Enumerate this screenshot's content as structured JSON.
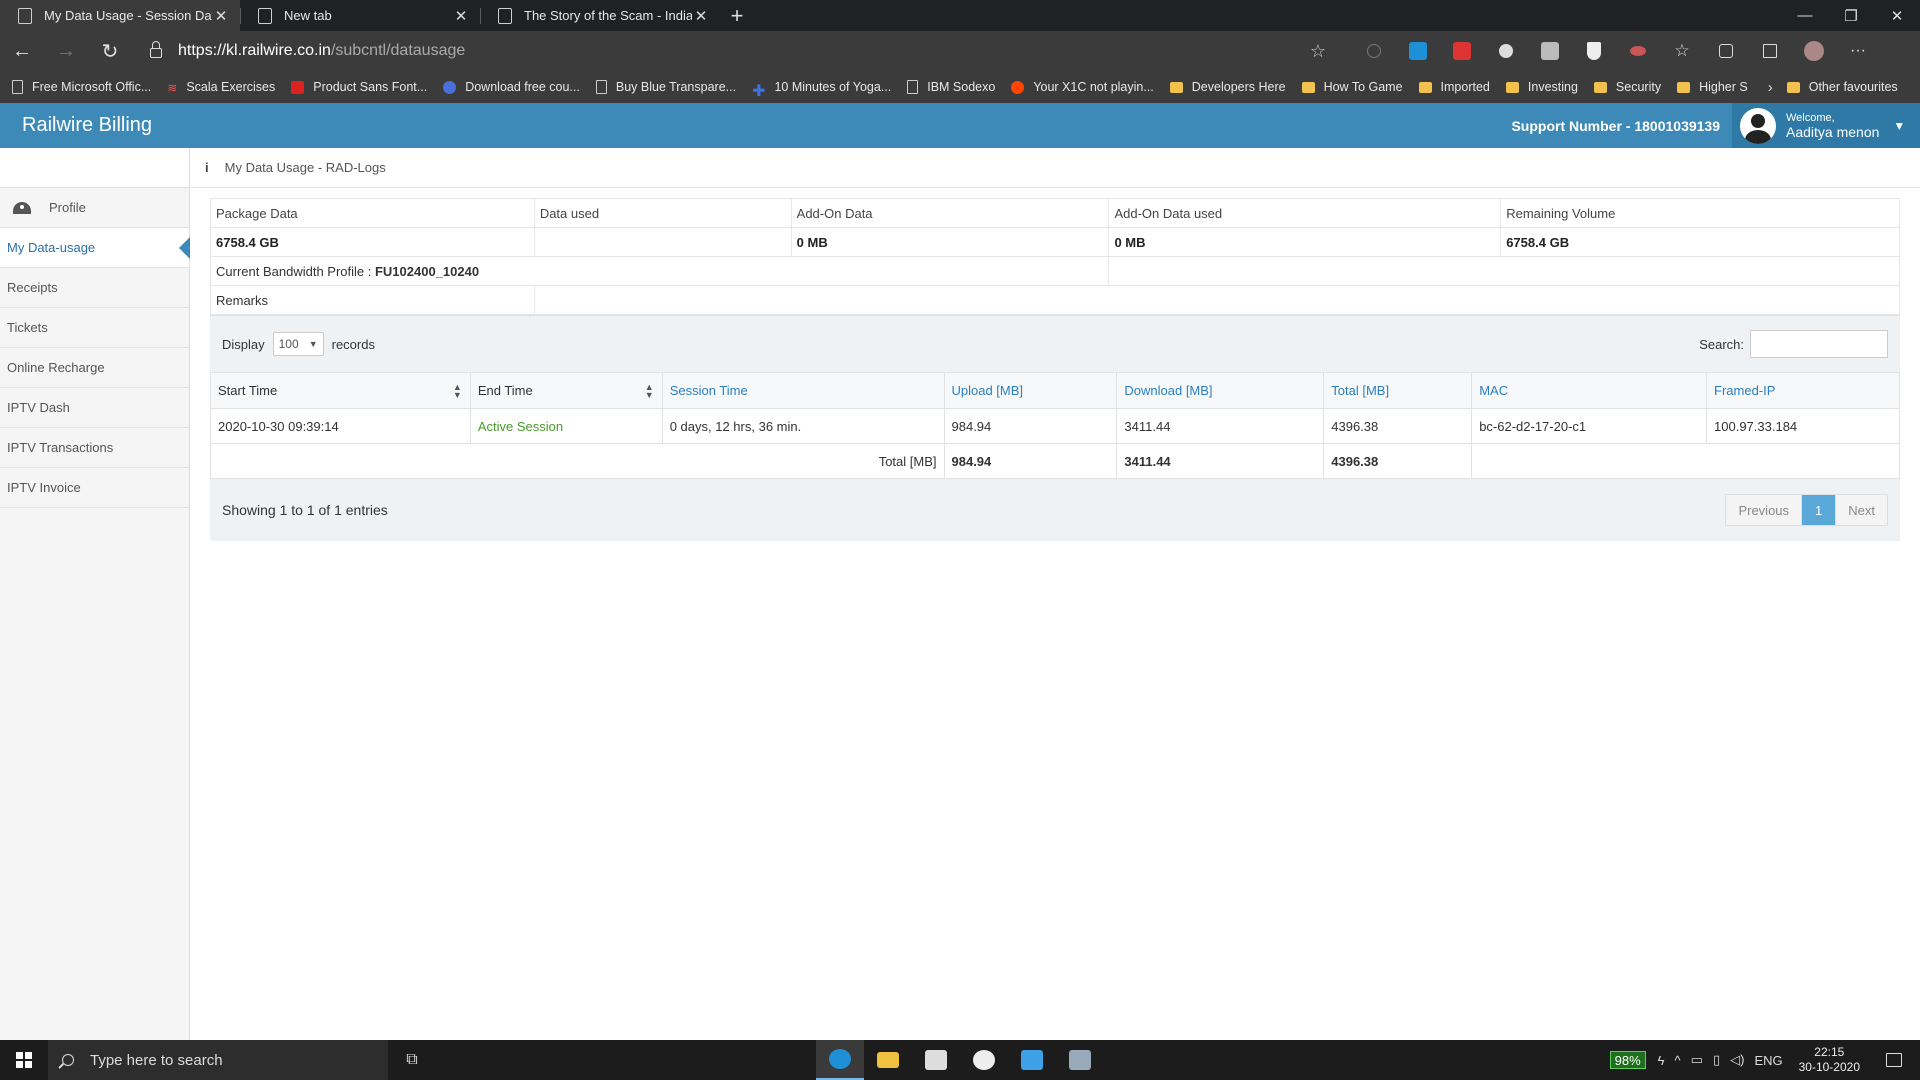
{
  "browser": {
    "tabs": [
      {
        "title": "My Data Usage - Session Data",
        "active": true
      },
      {
        "title": "New tab",
        "active": false
      },
      {
        "title": "The Story of the Scam - Indiasco",
        "active": false
      }
    ],
    "url_host": "https://kl.railwire.co.in",
    "url_path": "/subcntl/datausage",
    "bookmarks": [
      {
        "label": "Free Microsoft Offic...",
        "icon": "page-icon"
      },
      {
        "label": "Scala Exercises",
        "icon": "scala-icon"
      },
      {
        "label": "Product Sans Font...",
        "icon": "font-icon"
      },
      {
        "label": "Download free cou...",
        "icon": "globe-icon"
      },
      {
        "label": "Buy Blue Transpare...",
        "icon": "page-icon"
      },
      {
        "label": "10 Minutes of Yoga...",
        "icon": "plus-icon"
      },
      {
        "label": "IBM Sodexo",
        "icon": "page-icon"
      },
      {
        "label": "Your X1C not playin...",
        "icon": "reddit-icon"
      },
      {
        "label": "Developers Here",
        "icon": "folder-icon"
      },
      {
        "label": "How To Game",
        "icon": "folder-icon"
      },
      {
        "label": "Imported",
        "icon": "folder-icon"
      },
      {
        "label": "Investing",
        "icon": "folder-icon"
      },
      {
        "label": "Security",
        "icon": "folder-icon"
      },
      {
        "label": "Higher S",
        "icon": "folder-icon"
      }
    ],
    "other_favourites": "Other favourites"
  },
  "header": {
    "brand": "Railwire Billing",
    "support": "Support Number - 18001039139",
    "welcome": "Welcome,",
    "user_name": "Aaditya menon"
  },
  "sidebar": {
    "items": [
      {
        "label": "Profile",
        "active": false
      },
      {
        "label": "My Data-usage",
        "active": true
      },
      {
        "label": "Receipts",
        "active": false
      },
      {
        "label": "Tickets",
        "active": false
      },
      {
        "label": "Online Recharge",
        "active": false
      },
      {
        "label": "IPTV Dash",
        "active": false
      },
      {
        "label": "IPTV Transactions",
        "active": false
      },
      {
        "label": "IPTV Invoice",
        "active": false
      }
    ]
  },
  "breadcrumb": {
    "icon": "i",
    "text": "My Data Usage - RAD-Logs"
  },
  "summary": {
    "headers": [
      "Package Data",
      "Data used",
      "Add-On Data",
      "Add-On Data used",
      "Remaining Volume"
    ],
    "values": [
      "6758.4 GB",
      "",
      "0 MB",
      "0 MB",
      "6758.4 GB"
    ],
    "bandwidth_label": "Current Bandwidth Profile : ",
    "bandwidth_value": "FU102400_10240",
    "remarks_label": "Remarks"
  },
  "datatable": {
    "display_label": "Display",
    "page_size": "100",
    "records_label": "records",
    "search_label": "Search:",
    "columns": [
      "Start Time",
      "End Time",
      "Session Time",
      "Upload [MB]",
      "Download [MB]",
      "Total [MB]",
      "MAC",
      "Framed-IP"
    ],
    "rows": [
      {
        "start": "2020-10-30 09:39:14",
        "end": "Active Session",
        "session_time": "0 days, 12 hrs, 36 min.",
        "upload": "984.94",
        "download": "3411.44",
        "total": "4396.38",
        "mac": "bc-62-d2-17-20-c1",
        "ip": "100.97.33.184"
      }
    ],
    "totals": {
      "label": "Total [MB]",
      "upload": "984.94",
      "download": "3411.44",
      "total": "4396.38"
    },
    "info": "Showing 1 to 1 of 1 entries",
    "pager": {
      "previous": "Previous",
      "current": "1",
      "next": "Next"
    }
  },
  "taskbar": {
    "search_placeholder": "Type here to search",
    "battery": "98%",
    "language": "ENG",
    "time": "22:15",
    "date": "30-10-2020"
  },
  "colors": {
    "header_blue": "#3d8ab8",
    "link_blue": "#2b7fc1",
    "active_green": "#4a9a2a"
  }
}
